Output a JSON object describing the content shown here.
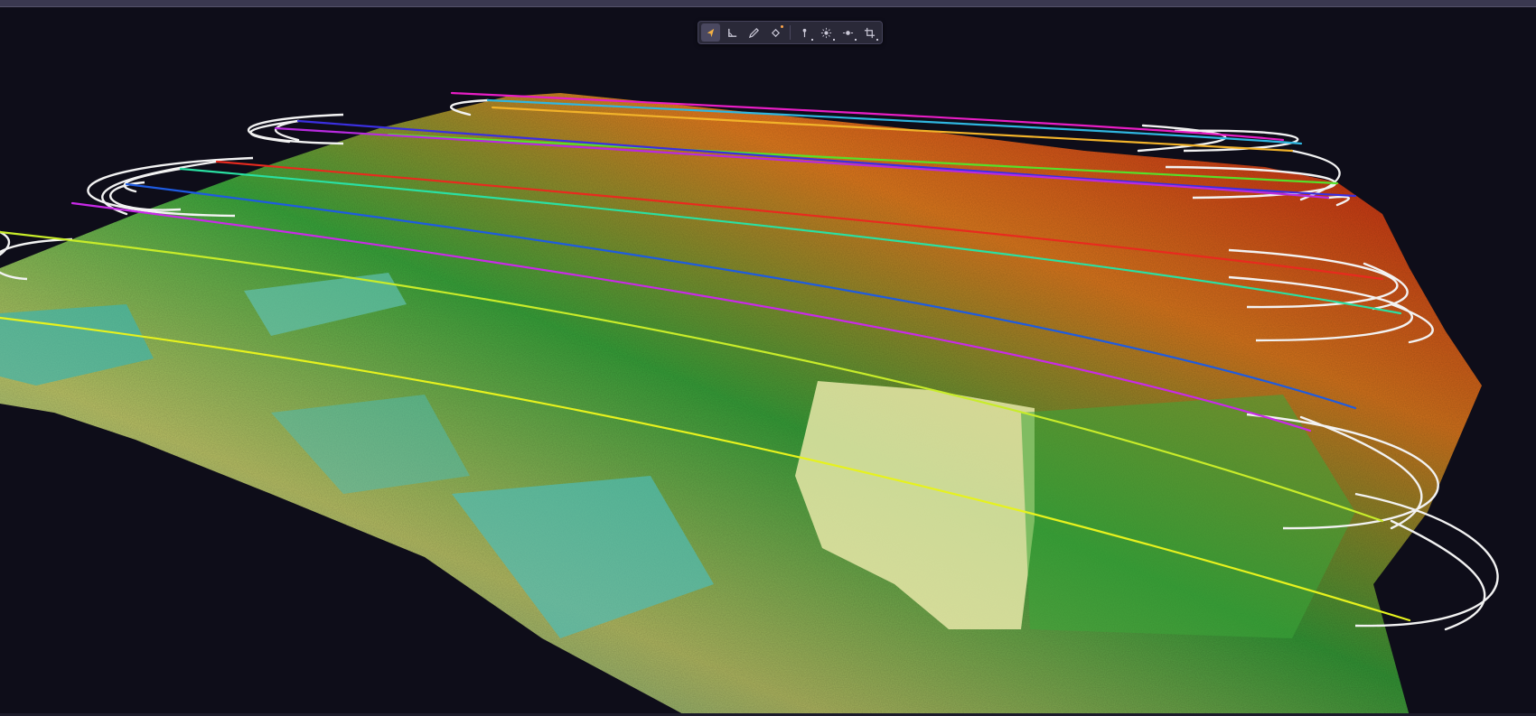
{
  "window": {
    "background": "#0e0d19"
  },
  "viewport": {
    "content": "lidar-point-cloud",
    "colors": {
      "low": "#3fb7b0",
      "mid_low": "#c8d16e",
      "mid": "#3aa83c",
      "high": "#e07a1e",
      "peak": "#c52a12",
      "loop": "#f2f2f2"
    }
  },
  "toolbar": {
    "tools": [
      {
        "name": "select-tool",
        "icon": "cursor-arrow-icon",
        "active": true
      },
      {
        "name": "measure-angle-tool",
        "icon": "angle-ruler-icon",
        "active": false
      },
      {
        "name": "pen-tool",
        "icon": "pen-icon",
        "active": false
      },
      {
        "name": "paint-bucket-tool",
        "icon": "paint-bucket-icon",
        "active": false
      },
      {
        "name": "point-pick-tool",
        "icon": "pin-icon",
        "active": false
      },
      {
        "name": "light-tool",
        "icon": "sun-icon",
        "active": false
      },
      {
        "name": "marker-tool",
        "icon": "target-dot-icon",
        "active": false
      },
      {
        "name": "crop-tool",
        "icon": "crop-icon",
        "active": false
      }
    ]
  },
  "flight_lines": [
    {
      "color": "#e81ec5"
    },
    {
      "color": "#2fb6e0"
    },
    {
      "color": "#f2b32a"
    },
    {
      "color": "#56e02a"
    },
    {
      "color": "#3b2fe0"
    },
    {
      "color": "#b92ae0"
    },
    {
      "color": "#e82a1e"
    },
    {
      "color": "#2ae0a2"
    },
    {
      "color": "#1e5be0"
    },
    {
      "color": "#c92ae8"
    },
    {
      "color": "#c8ec2a"
    },
    {
      "color": "#e6f21e"
    }
  ]
}
